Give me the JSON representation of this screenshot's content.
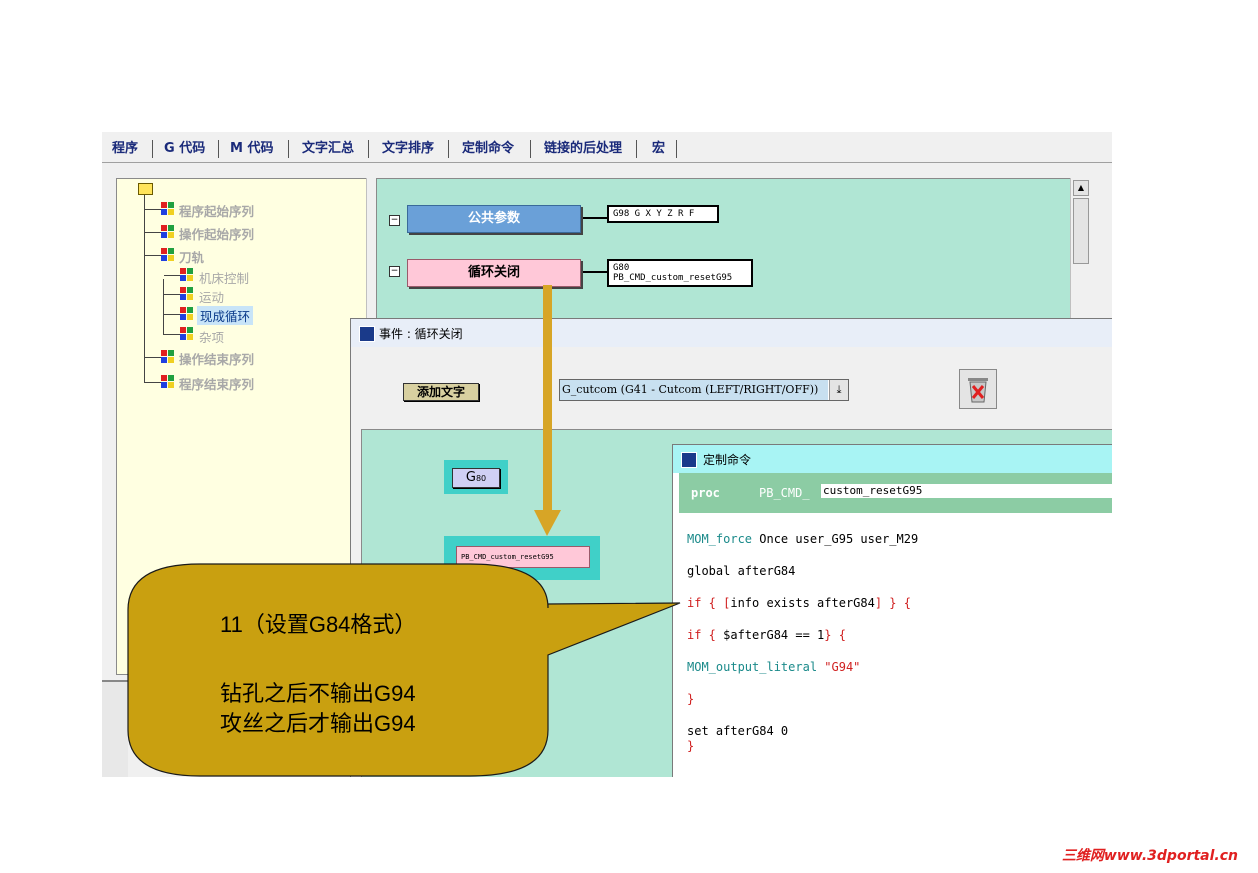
{
  "tabs": [
    "程序",
    "G 代码",
    "M 代码",
    "文字汇总",
    "文字排序",
    "定制命令",
    "链接的后处理",
    "宏"
  ],
  "tree": {
    "items": [
      {
        "label": "程序起始序列",
        "level": 1,
        "selected": false
      },
      {
        "label": "操作起始序列",
        "level": 1,
        "selected": false
      },
      {
        "label": "刀轨",
        "level": 1,
        "selected": false
      },
      {
        "label": "机床控制",
        "level": 2,
        "selected": false
      },
      {
        "label": "运动",
        "level": 2,
        "selected": false
      },
      {
        "label": "现成循环",
        "level": 2,
        "selected": true
      },
      {
        "label": "杂项",
        "level": 2,
        "selected": false
      },
      {
        "label": "操作结束序列",
        "level": 1,
        "selected": false
      },
      {
        "label": "程序结束序列",
        "level": 1,
        "selected": false
      }
    ]
  },
  "blocks": {
    "common": {
      "label": "公共参数",
      "code": "G98 G X Y Z R F"
    },
    "cycle_off": {
      "label": "循环关闭",
      "code": "G80\nPB_CMD_custom_resetG95"
    }
  },
  "event_dialog": {
    "title": "事件 : 循环关闭",
    "add_text_button": "添加文字",
    "combo_value": "G_cutcom (G41 - Cutcom (LEFT/RIGHT/OFF))",
    "g80_label": "G",
    "g80_sub": "80",
    "pb_block_label": "PB_CMD_custom_resetG95"
  },
  "custom_dialog": {
    "title": "定制命令",
    "proc_kw": "proc",
    "proc_prefix": "PB_CMD_",
    "proc_name": "custom_resetG95",
    "lines": {
      "l1a": "MOM_force",
      "l1b": " Once user_G95 user_M29",
      "l2": "global afterG84",
      "l3a": "if { [",
      "l3b": "info exists afterG84",
      "l3c": "] } {",
      "l4a": "if { ",
      "l4b": "$afterG84 == 1",
      "l4c": "} {",
      "l5a": "MOM_output_literal ",
      "l5b": "\"G94\"",
      "l6": "}",
      "l7": "set afterG84 0",
      "l8": "}"
    }
  },
  "callout": {
    "line1": "11（设置G84格式）",
    "line2": "钻孔之后不输出G94",
    "line3": "攻丝之后才输出G94"
  },
  "watermark": "三维网www.3dportal.cn",
  "colors": {
    "callout_fill": "#c9a010",
    "arrow": "#d7a526",
    "green_panel": "#b0e6d4",
    "tree_bg": "#ffffe1"
  }
}
